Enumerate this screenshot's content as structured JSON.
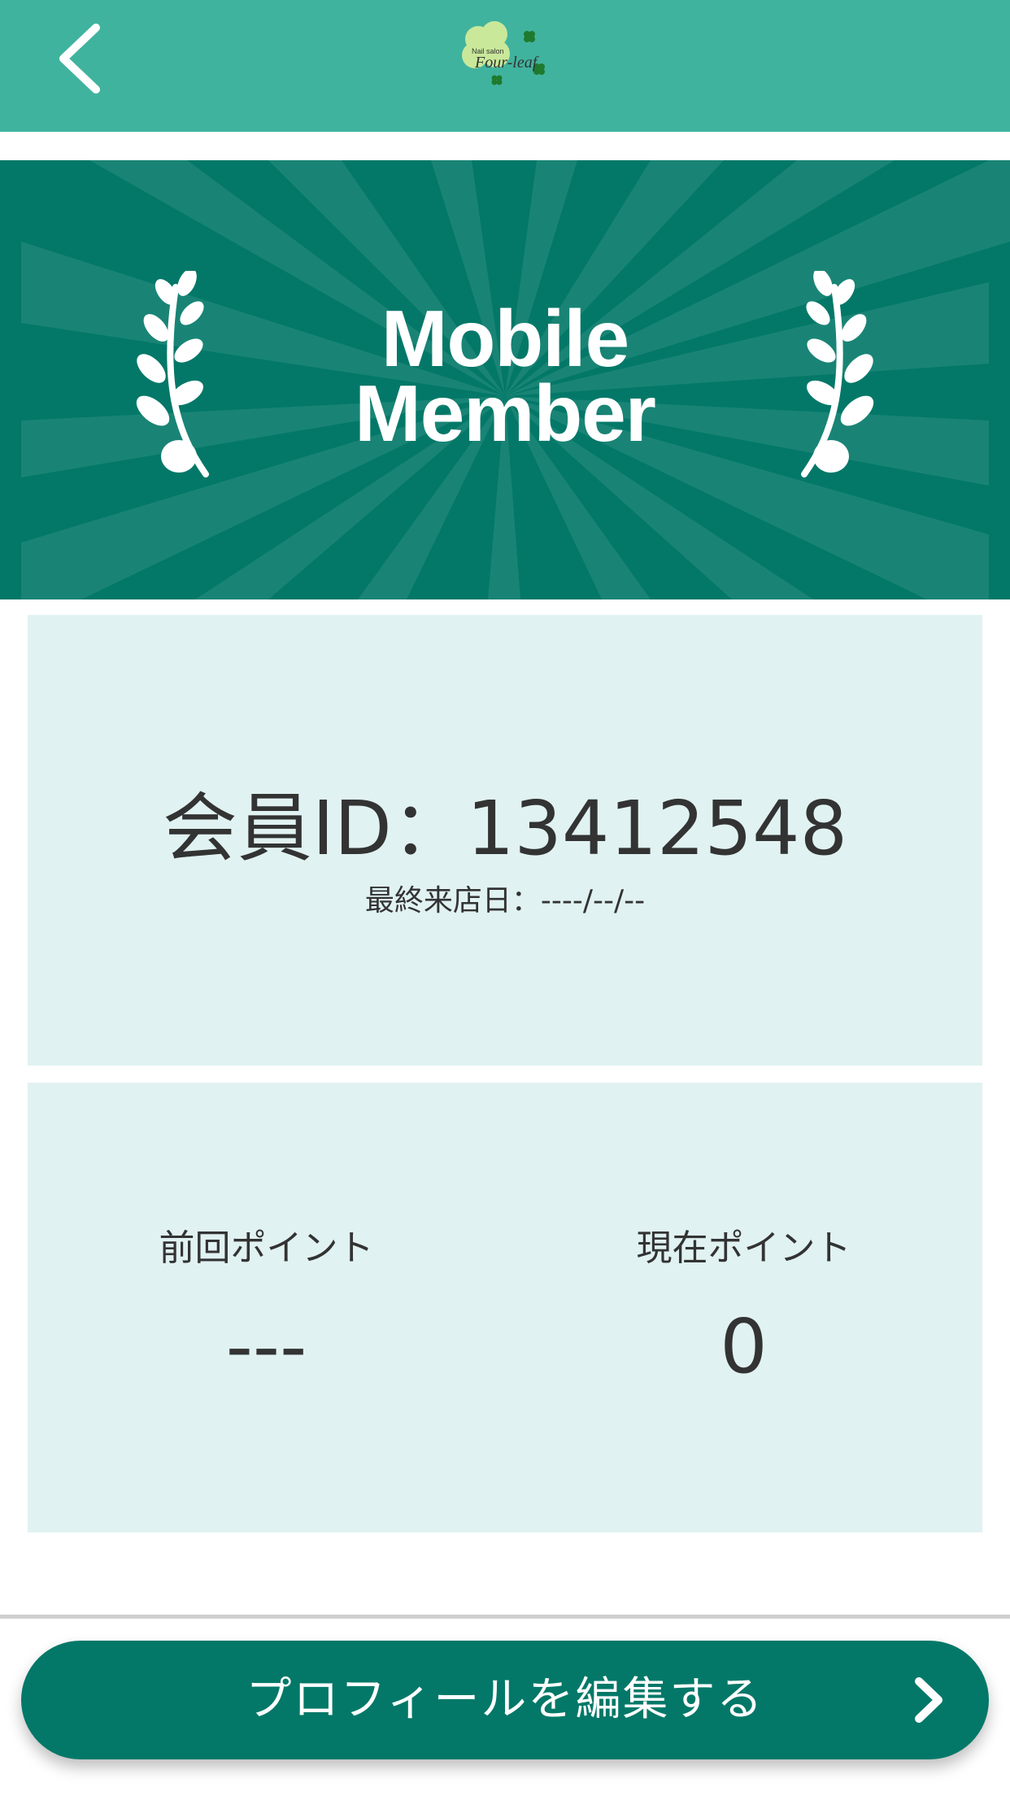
{
  "header": {
    "back_icon": "chevron-left-icon",
    "logo": {
      "small_text": "Nail salon",
      "main_text": "Four-leaf"
    },
    "background_color": "#40b39e"
  },
  "banner": {
    "title_line1": "Mobile",
    "title_line2": "Member",
    "background_color": "#037868"
  },
  "member": {
    "id_label": "会員ID：",
    "id_value": "13412548",
    "last_visit_label": "最終来店日：",
    "last_visit_value": "----/--/--"
  },
  "points": {
    "previous_label": "前回ポイント",
    "previous_value": "---",
    "current_label": "現在ポイント",
    "current_value": "0"
  },
  "actions": {
    "edit_profile_label": "プロフィールを編集する",
    "edit_profile_icon": "chevron-right-icon"
  },
  "colors": {
    "card_background": "#e0f2f1",
    "button_background": "#037868"
  }
}
